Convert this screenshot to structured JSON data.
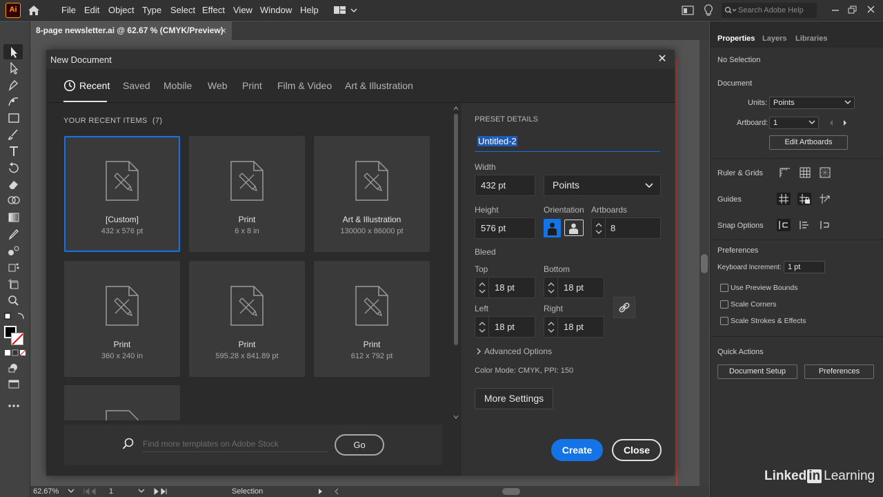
{
  "app": {
    "logo": "Ai",
    "menu": [
      "File",
      "Edit",
      "Object",
      "Type",
      "Select",
      "Effect",
      "View",
      "Window",
      "Help"
    ],
    "search_placeholder": "Search Adobe Help"
  },
  "document_tab": {
    "title": "8-page newsletter.ai @ 62.67 % (CMYK/Preview)",
    "close": "×"
  },
  "dialog": {
    "title": "New Document",
    "close": "✕",
    "tabs": [
      "Recent",
      "Saved",
      "Mobile",
      "Web",
      "Print",
      "Film & Video",
      "Art & Illustration"
    ],
    "active_tab": "Recent",
    "recent_heading": "YOUR RECENT ITEMS",
    "recent_count": "(7)",
    "recent_items": [
      {
        "title": "[Custom]",
        "size": "432 x 576 pt",
        "selected": true
      },
      {
        "title": "Print",
        "size": "6 x 8 in"
      },
      {
        "title": "Art & Illustration",
        "size": "130000 x 86000 pt"
      },
      {
        "title": "Print",
        "size": "360 x 240 in"
      },
      {
        "title": "Print",
        "size": "595.28 x 841.89 pt"
      },
      {
        "title": "Print",
        "size": "612 x 792 pt"
      }
    ],
    "stock_placeholder": "Find more templates on Adobe Stock",
    "go_label": "Go",
    "preset": {
      "heading": "PRESET DETAILS",
      "name": "Untitled-2",
      "width_label": "Width",
      "width_value": "432 pt",
      "units": "Points",
      "height_label": "Height",
      "height_value": "576 pt",
      "orientation_label": "Orientation",
      "artboards_label": "Artboards",
      "artboards_value": "8",
      "bleed_label": "Bleed",
      "top_label": "Top",
      "top_value": "18 pt",
      "bottom_label": "Bottom",
      "bottom_value": "18 pt",
      "left_label": "Left",
      "left_value": "18 pt",
      "right_label": "Right",
      "right_value": "18 pt",
      "advanced_label": "Advanced Options",
      "color_mode": "Color Mode: CMYK, PPI: 150",
      "more_settings": "More Settings",
      "create": "Create",
      "close": "Close"
    }
  },
  "properties_panel": {
    "tabs": [
      "Properties",
      "Layers",
      "Libraries"
    ],
    "no_selection": "No Selection",
    "document_heading": "Document",
    "units_label": "Units:",
    "units_value": "Points",
    "artboard_label": "Artboard:",
    "artboard_value": "1",
    "edit_artboards": "Edit Artboards",
    "ruler_grids": "Ruler & Grids",
    "guides": "Guides",
    "snap_options": "Snap Options",
    "preferences_heading": "Preferences",
    "keyboard_increment_label": "Keyboard Increment:",
    "keyboard_increment_value": "1 pt",
    "use_preview_bounds": "Use Preview Bounds",
    "scale_corners": "Scale Corners",
    "scale_strokes": "Scale Strokes & Effects",
    "quick_actions": "Quick Actions",
    "document_setup": "Document Setup",
    "preferences_button": "Preferences"
  },
  "status_bar": {
    "zoom": "62.67%",
    "artboard": "1",
    "tool": "Selection"
  },
  "watermark": {
    "linked": "Linked",
    "in": "in",
    "learning": "Learning"
  }
}
